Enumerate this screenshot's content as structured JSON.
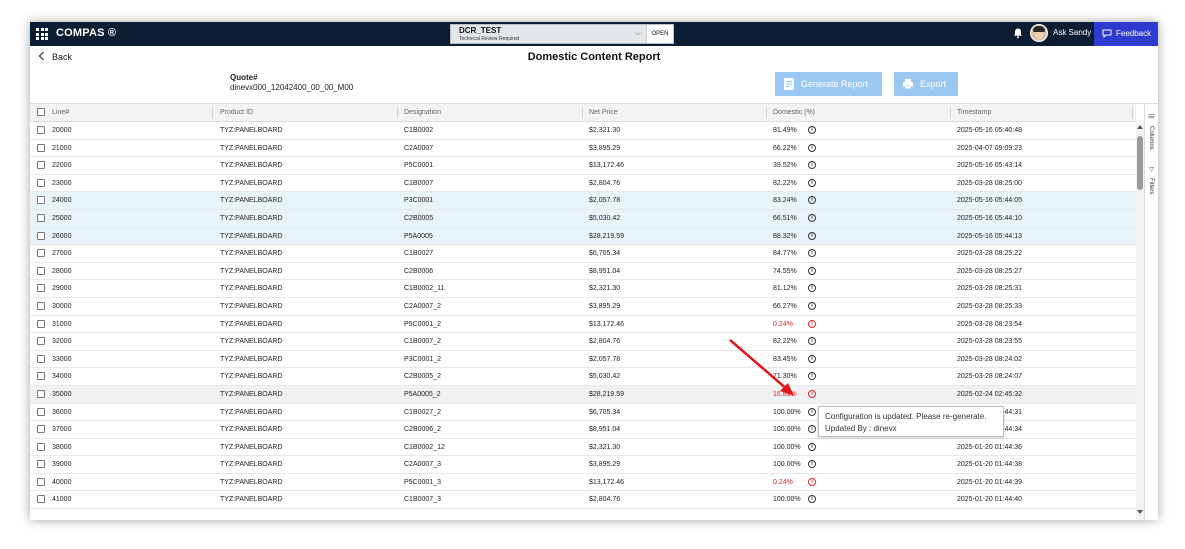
{
  "app": {
    "title": "COMPAS ®"
  },
  "quote_selector": {
    "name": "DCR_TEST",
    "status": "Technical Review Required",
    "badge": "OPEN"
  },
  "user": {
    "label": "Ask Sandy"
  },
  "feedback": {
    "label": "Feedback"
  },
  "nav": {
    "back": "Back"
  },
  "page": {
    "title": "Domestic Content Report",
    "quote_label": "Quote#",
    "quote_number": "dinevx000_12042400_00_00_M00",
    "generate_report": "Generate Report",
    "export": "Export"
  },
  "grid": {
    "columns": [
      "Line#",
      "Product ID",
      "Designation",
      "Net Price",
      "Domestic (%)",
      "Timestamp"
    ],
    "side_tabs": {
      "columns": "Columns",
      "filters": "Filters"
    },
    "rows": [
      {
        "line": "20000",
        "product": "TYZ:PANELBOARD",
        "designation": "C1B0002",
        "price": "$2,321.30",
        "domestic": "81.49%",
        "timestamp": "2025-05-16 05:40:48"
      },
      {
        "line": "21000",
        "product": "TYZ:PANELBOARD",
        "designation": "C2A0007",
        "price": "$3,895.29",
        "domestic": "66.22%",
        "timestamp": "2025-04-07 09:09:23"
      },
      {
        "line": "22000",
        "product": "TYZ:PANELBOARD",
        "designation": "P5C0001",
        "price": "$13,172.46",
        "domestic": "39.52%",
        "timestamp": "2025-05-16 05:43:14"
      },
      {
        "line": "23000",
        "product": "TYZ:PANELBOARD",
        "designation": "C1B0007",
        "price": "$2,804.76",
        "domestic": "82.22%",
        "timestamp": "2025-03-28 08:25:00"
      },
      {
        "line": "24000",
        "product": "TYZ:PANELBOARD",
        "designation": "P3C0001",
        "price": "$2,057.78",
        "domestic": "83.24%",
        "timestamp": "2025-05-16 05:44:05"
      },
      {
        "line": "25000",
        "product": "TYZ:PANELBOARD",
        "designation": "C2B0005",
        "price": "$5,030.42",
        "domestic": "66.51%",
        "timestamp": "2025-05-16 05:44:10"
      },
      {
        "line": "26000",
        "product": "TYZ:PANELBOARD",
        "designation": "P5A0005",
        "price": "$28,219.59",
        "domestic": "88.32%",
        "timestamp": "2025-05-16 05:44:13"
      },
      {
        "line": "27000",
        "product": "TYZ:PANELBOARD",
        "designation": "C1B0027",
        "price": "$6,705.34",
        "domestic": "84.77%",
        "timestamp": "2025-03-28 08:25:22"
      },
      {
        "line": "28000",
        "product": "TYZ:PANELBOARD",
        "designation": "C2B0006",
        "price": "$8,951.04",
        "domestic": "74.55%",
        "timestamp": "2025-03-28 08:25:27"
      },
      {
        "line": "29000",
        "product": "TYZ:PANELBOARD",
        "designation": "C1B0002_11",
        "price": "$2,321.30",
        "domestic": "81.12%",
        "timestamp": "2025-03-28 08:25:31"
      },
      {
        "line": "30000",
        "product": "TYZ:PANELBOARD",
        "designation": "C2A0007_2",
        "price": "$3,895.29",
        "domestic": "66.27%",
        "timestamp": "2025-03-28 08:25:33"
      },
      {
        "line": "31000",
        "product": "TYZ:PANELBOARD",
        "designation": "P5C0001_2",
        "price": "$13,172.46",
        "domestic": "0.24%",
        "timestamp": "2025-03-28 08:23:54"
      },
      {
        "line": "32000",
        "product": "TYZ:PANELBOARD",
        "designation": "C1B0007_2",
        "price": "$2,804.76",
        "domestic": "82.22%",
        "timestamp": "2025-03-28 08:23:55"
      },
      {
        "line": "33000",
        "product": "TYZ:PANELBOARD",
        "designation": "P3C0001_2",
        "price": "$2,057.78",
        "domestic": "83.45%",
        "timestamp": "2025-03-28 08:24:02"
      },
      {
        "line": "34000",
        "product": "TYZ:PANELBOARD",
        "designation": "C2B0005_2",
        "price": "$5,030.42",
        "domestic": "71.30%",
        "timestamp": "2025-03-28 08:24:07"
      },
      {
        "line": "35000",
        "product": "TYZ:PANELBOARD",
        "designation": "P5A0005_2",
        "price": "$28,219.59",
        "domestic": "16.81%",
        "timestamp": "2025-02-24 02:45:32"
      },
      {
        "line": "36000",
        "product": "TYZ:PANELBOARD",
        "designation": "C1B0027_2",
        "price": "$6,705.34",
        "domestic": "100.00%",
        "timestamp": "2025-02-24 02:44:31"
      },
      {
        "line": "37000",
        "product": "TYZ:PANELBOARD",
        "designation": "C2B0006_2",
        "price": "$8,951.04",
        "domestic": "100.00%",
        "timestamp": "2025-02-24 02:44:34"
      },
      {
        "line": "38000",
        "product": "TYZ:PANELBOARD",
        "designation": "C1B0002_12",
        "price": "$2,321.30",
        "domestic": "100.00%",
        "timestamp": "2025-01-20 01:44:36"
      },
      {
        "line": "39000",
        "product": "TYZ:PANELBOARD",
        "designation": "C2A0007_3",
        "price": "$3,895.29",
        "domestic": "100.00%",
        "timestamp": "2025-01-20 01:44:38"
      },
      {
        "line": "40000",
        "product": "TYZ:PANELBOARD",
        "designation": "P5C0001_3",
        "price": "$13,172.46",
        "domestic": "0.24%",
        "timestamp": "2025-01-20 01:44:39"
      },
      {
        "line": "41000",
        "product": "TYZ:PANELBOARD",
        "designation": "C1B0007_3",
        "price": "$2,804.76",
        "domestic": "100.00%",
        "timestamp": "2025-01-20 01:44:40"
      }
    ],
    "row_states": [
      "",
      "",
      "",
      "",
      "sel",
      "sel",
      "sel",
      "",
      "",
      "",
      "",
      "red",
      "",
      "",
      "",
      "hover-red",
      "",
      "",
      "",
      "",
      "red",
      ""
    ]
  },
  "tooltip": {
    "line1": "Configuration is updated. Please re-generate.",
    "line2": "Updated By : dinevx"
  },
  "colors": {
    "topbar": "#0b1d33",
    "feedback": "#2e3bd1",
    "button": "#9bc8f0",
    "warning": "#e02424",
    "selected_row": "#e8f4fc"
  }
}
